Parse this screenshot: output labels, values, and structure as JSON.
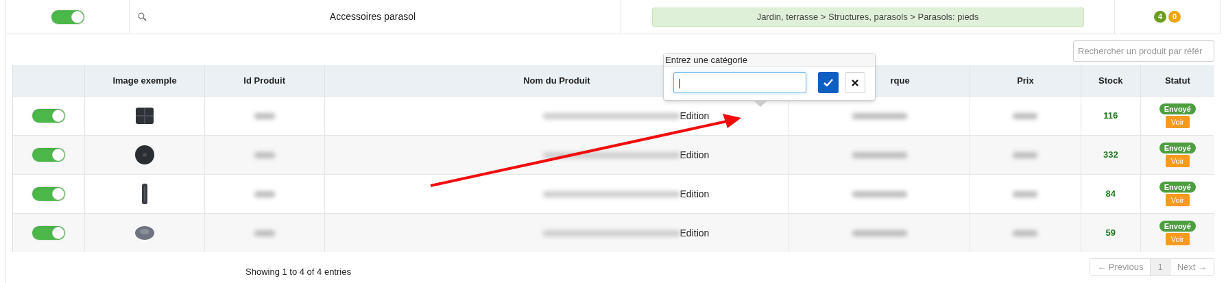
{
  "category_row": {
    "active": true,
    "name": "Accessoires parasol",
    "path": "Jardin, terrasse > Structures, parasols > Parasols: pieds",
    "badges": [
      {
        "text": "4",
        "color": "#6b9e1f"
      },
      {
        "text": "0",
        "color": "#f0a30a"
      }
    ]
  },
  "search": {
    "placeholder": "Rechercher un produit par référ"
  },
  "table": {
    "columns": [
      "",
      "Image exemple",
      "Id Produit",
      "Nom du Produit",
      "rque",
      "Prix",
      "Stock",
      "Statut"
    ],
    "rows": [
      {
        "active": true,
        "edit": "Edition",
        "stock": "116",
        "status": "Envoyé",
        "action": "Voir"
      },
      {
        "active": true,
        "edit": "Edition",
        "stock": "332",
        "status": "Envoyé",
        "action": "Voir"
      },
      {
        "active": true,
        "edit": "Edition",
        "stock": "84",
        "status": "Envoyé",
        "action": "Voir"
      },
      {
        "active": true,
        "edit": "Edition",
        "stock": "59",
        "status": "Envoyé",
        "action": "Voir"
      }
    ]
  },
  "popup": {
    "title": "Entrez une catégorie",
    "value": "|"
  },
  "footer": {
    "info": "Showing 1 to 4 of 4 entries",
    "pagination": [
      {
        "label": "← Previous",
        "selected": false
      },
      {
        "label": "1",
        "selected": true
      },
      {
        "label": "Next →",
        "selected": false
      }
    ]
  }
}
